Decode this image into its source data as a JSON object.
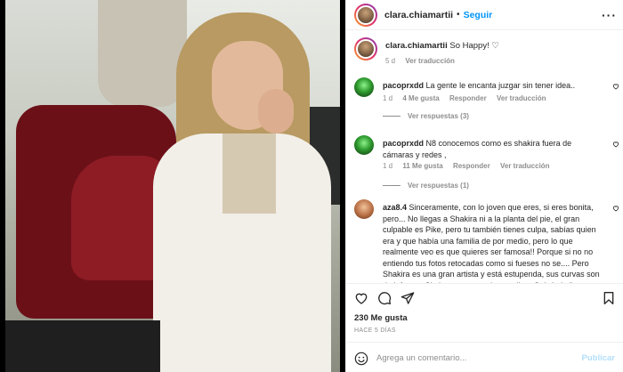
{
  "post": {
    "username": "clara.chiamartii",
    "dot": "•",
    "follow_label": "Seguir",
    "more_label": "···"
  },
  "caption": {
    "username": "clara.chiamartii",
    "text": "So Happy! ♡",
    "age": "5 d",
    "translate": "Ver traducción"
  },
  "comments": [
    {
      "username": "pacoprxdd",
      "text": "La gente le encanta juzgar sin tener idea..",
      "age": "1 d",
      "likes": "4 Me gusta",
      "reply": "Responder",
      "translate": "Ver traducción",
      "replies": "Ver respuestas (3)"
    },
    {
      "username": "pacoprxdd",
      "text": "N8 conocemos como es shakira fuera de cámaras y redes ,",
      "age": "1 d",
      "likes": "11 Me gusta",
      "reply": "Responder",
      "translate": "Ver traducción",
      "replies": "Ver respuestas (1)"
    },
    {
      "username": "aza8.4",
      "text": "Sinceramente, con lo joven que eres, si eres bonita, pero... No llegas a Shakira ni a la planta del pie, el gran culpable es Pike, pero tu también tienes culpa, sabías quien era y que había una familia de por medio, pero lo que realmente veo es que quieres ser famosa!! Porque si no no entiendo tus fotos retocadas como si fueses no se.... Pero Shakira es una gran artista y está estupenda, sus curvas son de infarto... Si piensas competir con ella... Quizás lo llevas claro, disfruta de"
    }
  ],
  "likes_count": "230 Me gusta",
  "posted_ago": "HACE 5 DÍAS",
  "add_comment": {
    "placeholder": "Agrega un comentario...",
    "post_label": "Publicar"
  },
  "colors": {
    "accent": "#0095f6",
    "post_disabled": "#b2dffc",
    "muted": "#8e8e8e",
    "text": "#262626"
  },
  "icons": {
    "like": "heart-icon",
    "comment": "comment-icon",
    "share": "paper-plane-icon",
    "save": "bookmark-icon",
    "emoji": "smiley-icon",
    "more": "more-dots-icon"
  }
}
